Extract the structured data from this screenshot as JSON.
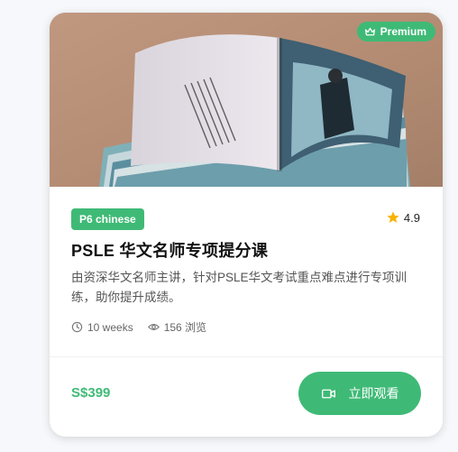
{
  "card": {
    "premium_label": "Premium",
    "category_tag": "P6 chinese",
    "rating": "4.9",
    "title": "PSLE 华文名师专项提分课",
    "description": "由资深华文名师主讲，针对PSLE华文考试重点难点进行专项训练，助你提升成绩。",
    "duration": "10 weeks",
    "views": "156 浏览",
    "price": "S$399",
    "watch_button_label": "立即观看",
    "icons": {
      "premium": "crown-icon",
      "rating": "star-icon",
      "duration": "clock-icon",
      "views": "eye-icon",
      "watch": "video-camera-icon"
    },
    "colors": {
      "accent": "#3fba76",
      "star": "#f5b400",
      "hero_background": "#b38b70"
    }
  }
}
